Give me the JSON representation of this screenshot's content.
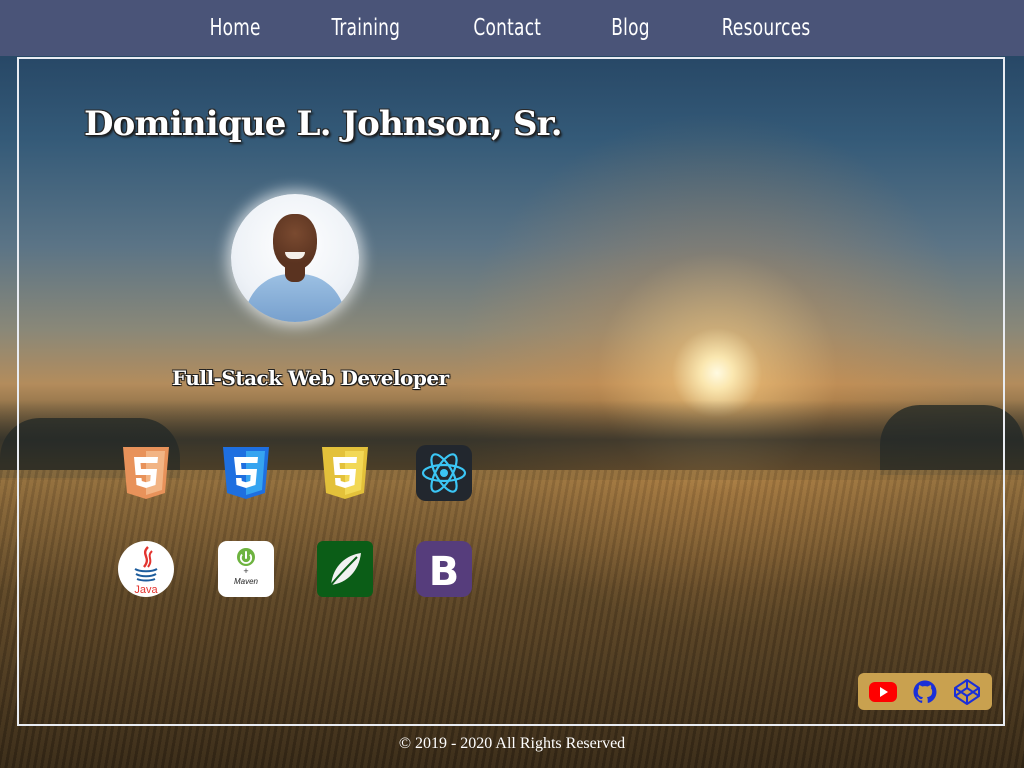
{
  "nav": {
    "items": [
      {
        "label": "Home"
      },
      {
        "label": "Training"
      },
      {
        "label": "Contact"
      },
      {
        "label": "Blog"
      },
      {
        "label": "Resources"
      }
    ]
  },
  "hero": {
    "name": "Dominique L. Johnson, Sr.",
    "role": "Full-Stack Web Developer"
  },
  "skills": {
    "row1": [
      "html5-icon",
      "css3-icon",
      "sass-icon",
      "react-icon"
    ],
    "row2": [
      "java-icon",
      "spring-maven-icon",
      "thymeleaf-icon",
      "bootstrap-icon"
    ],
    "java_label": "Java",
    "maven_label": "Maven",
    "bootstrap_label": "B"
  },
  "social": {
    "icons": [
      "youtube-icon",
      "github-icon",
      "codepen-icon"
    ],
    "colors": {
      "youtube": "#ff0000",
      "github": "#1a2fd8",
      "codepen": "#1a2fd8",
      "background": "#c9a14f"
    }
  },
  "footer": {
    "text": "© 2019 - 2020 All Rights Reserved"
  },
  "colors": {
    "nav_bg": "#4a5478",
    "frame_border": "#e9ecf2"
  }
}
